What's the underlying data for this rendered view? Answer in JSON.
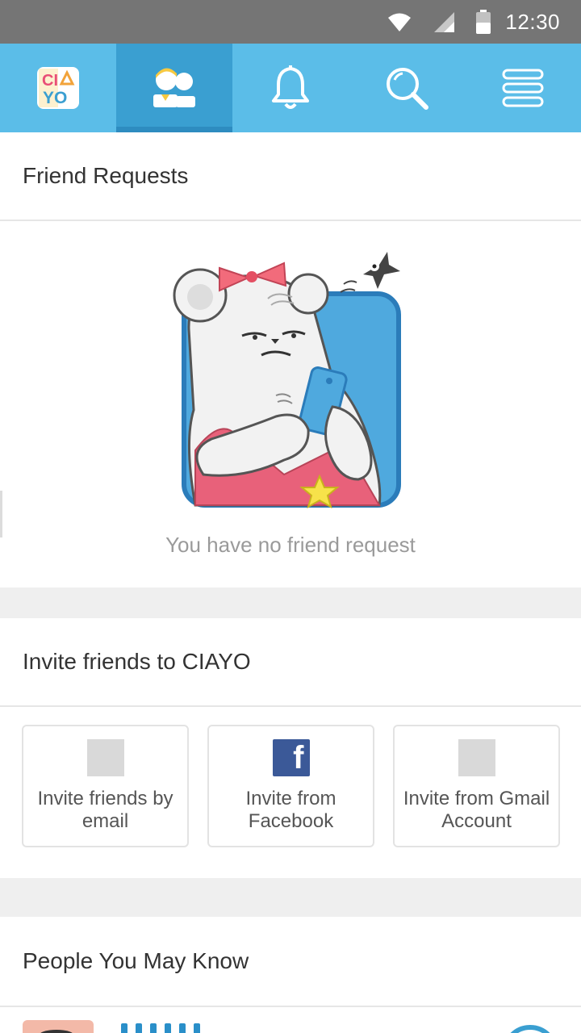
{
  "status_bar": {
    "time": "12:30"
  },
  "nav": {
    "items": [
      {
        "name": "ciayo-logo",
        "active": false
      },
      {
        "name": "friends",
        "active": true
      },
      {
        "name": "notifications",
        "active": false
      },
      {
        "name": "search",
        "active": false
      },
      {
        "name": "menu",
        "active": false
      }
    ],
    "logo_text_top": "CIA",
    "logo_text_bottom": "YO"
  },
  "friend_requests": {
    "title": "Friend Requests",
    "empty_message": "You have no friend request"
  },
  "invite": {
    "title": "Invite friends to CIAYO",
    "cards": [
      {
        "label": "Invite friends by email",
        "icon": "email-placeholder-icon"
      },
      {
        "label": "Invite from Facebook",
        "icon": "facebook-icon"
      },
      {
        "label": "Invite from Gmail Account",
        "icon": "gmail-placeholder-icon"
      }
    ]
  },
  "people": {
    "title": "People You May Know"
  },
  "colors": {
    "nav_bg": "#5BBDE8",
    "nav_active": "#3A9FD1",
    "status_bar": "#757575",
    "facebook": "#3b5998"
  }
}
